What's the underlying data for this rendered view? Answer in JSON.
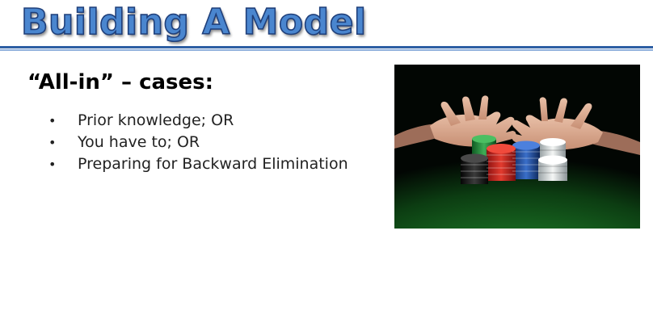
{
  "slide": {
    "title": "Building A Model",
    "subtitle": "“All-in” – cases:",
    "bullets": [
      "Prior knowledge; OR",
      "You have to; OR",
      "Preparing for Backward Elimination"
    ],
    "bullet_symbol": "•"
  },
  "photo": {
    "subject": "hands-pushing-poker-chips-icon"
  },
  "colors": {
    "title_fill": "#4a86cf",
    "title_outline": "#1f3f7a",
    "rule": "#2e5fa4",
    "felt": "#1f7d2c"
  }
}
